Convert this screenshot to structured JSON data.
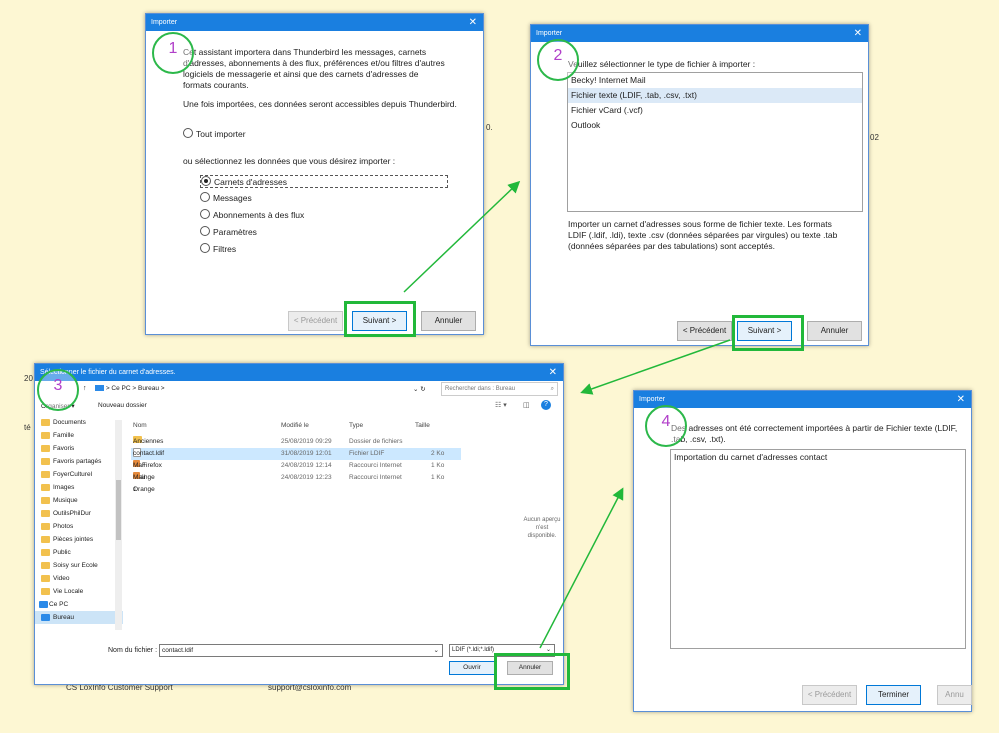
{
  "bg": {
    "t1": "0.",
    "t2": "02",
    "t3": "20",
    "t4": "té",
    "t5": "CS LoxInfo Customer Support",
    "t6": "support@csloxinfo.com"
  },
  "step1": {
    "num": "1",
    "title": "Importer",
    "intro": "Cet assistant importera dans Thunderbird les messages, carnets d'adresses, abonnements à des flux, préférences et/ou filtres d'autres logiciels de messagerie et ainsi que des carnets d'adresses de formats courants.",
    "after": "Une fois importées, ces données seront accessibles depuis Thunderbird.",
    "import_all": "Tout importer",
    "or_select": "ou sélectionnez les données que vous désirez importer :",
    "options": [
      "Carnets d'adresses",
      "Messages",
      "Abonnements à des flux",
      "Paramètres",
      "Filtres"
    ],
    "prev": "< Précédent",
    "next": "Suivant >",
    "cancel": "Annuler"
  },
  "step2": {
    "num": "2",
    "title": "Importer",
    "prompt": "Veuillez sélectionner le type de fichier à importer :",
    "types": [
      "Becky! Internet Mail",
      "Fichier texte (LDIF, .tab, .csv, .txt)",
      "Fichier vCard (.vcf)",
      "Outlook"
    ],
    "desc": "Importer un carnet d'adresses sous forme de fichier texte. Les formats LDIF (.ldif, .ldi), texte .csv (données séparées par virgules) ou texte .tab (données séparées par des tabulations) sont acceptés.",
    "prev": "< Précédent",
    "next": "Suivant >",
    "cancel": "Annuler"
  },
  "step3": {
    "num": "3",
    "title": "Sélectionner le fichier du carnet d'adresses.",
    "path": [
      "Ce PC",
      ">",
      "Bureau",
      ">"
    ],
    "search_placeholder": "Rechercher dans : Bureau",
    "organize": "Organiser ▾",
    "new_folder": "Nouveau dossier",
    "nav": [
      "Documents",
      "Famille",
      "Favoris",
      "Favoris partagés",
      "FoyerCulturel",
      "Images",
      "Musique",
      "OutilsPhilDur",
      "Photos",
      "Pièces jointes",
      "Public",
      "Soisy sur Ecole",
      "Video",
      "Vie Locale"
    ],
    "nav_pc": "Ce PC",
    "nav_bureau": "Bureau",
    "cols": [
      "Nom",
      "Modifié le",
      "Type",
      "Taille"
    ],
    "files": [
      {
        "name": "Anciennes données de Firefox",
        "date": "25/08/2019 09:29",
        "type": "Dossier de fichiers",
        "size": ""
      },
      {
        "name": "contact.ldif",
        "date": "31/08/2019 12:01",
        "type": "Fichier LDIF",
        "size": "2 Ko"
      },
      {
        "name": "Mail Orange 1",
        "date": "24/08/2019 12:14",
        "type": "Raccourci Internet",
        "size": "1 Ko"
      },
      {
        "name": "Mail Orange",
        "date": "24/08/2019 12:23",
        "type": "Raccourci Internet",
        "size": "1 Ko"
      }
    ],
    "preview": "Aucun aperçu n'est disponible.",
    "filename_label": "Nom du fichier :",
    "filename_value": "contact.ldif",
    "filter": "LDIF (*.ldi;*.ldif)",
    "open": "Ouvrir",
    "cancel": "Annuler"
  },
  "step4": {
    "num": "4",
    "title": "Importer",
    "msg": "Des adresses ont été correctement importées à partir de Fichier texte (LDIF, .tab, .csv, .txt).",
    "log": "Importation du carnet d'adresses contact",
    "prev": "< Précédent",
    "finish": "Terminer",
    "cancel": "Annu"
  },
  "colors": {
    "accent": "#1a7fe0",
    "highlight": "#22b83a",
    "step_number": "#b13fc9",
    "background": "#fdf7d3"
  }
}
